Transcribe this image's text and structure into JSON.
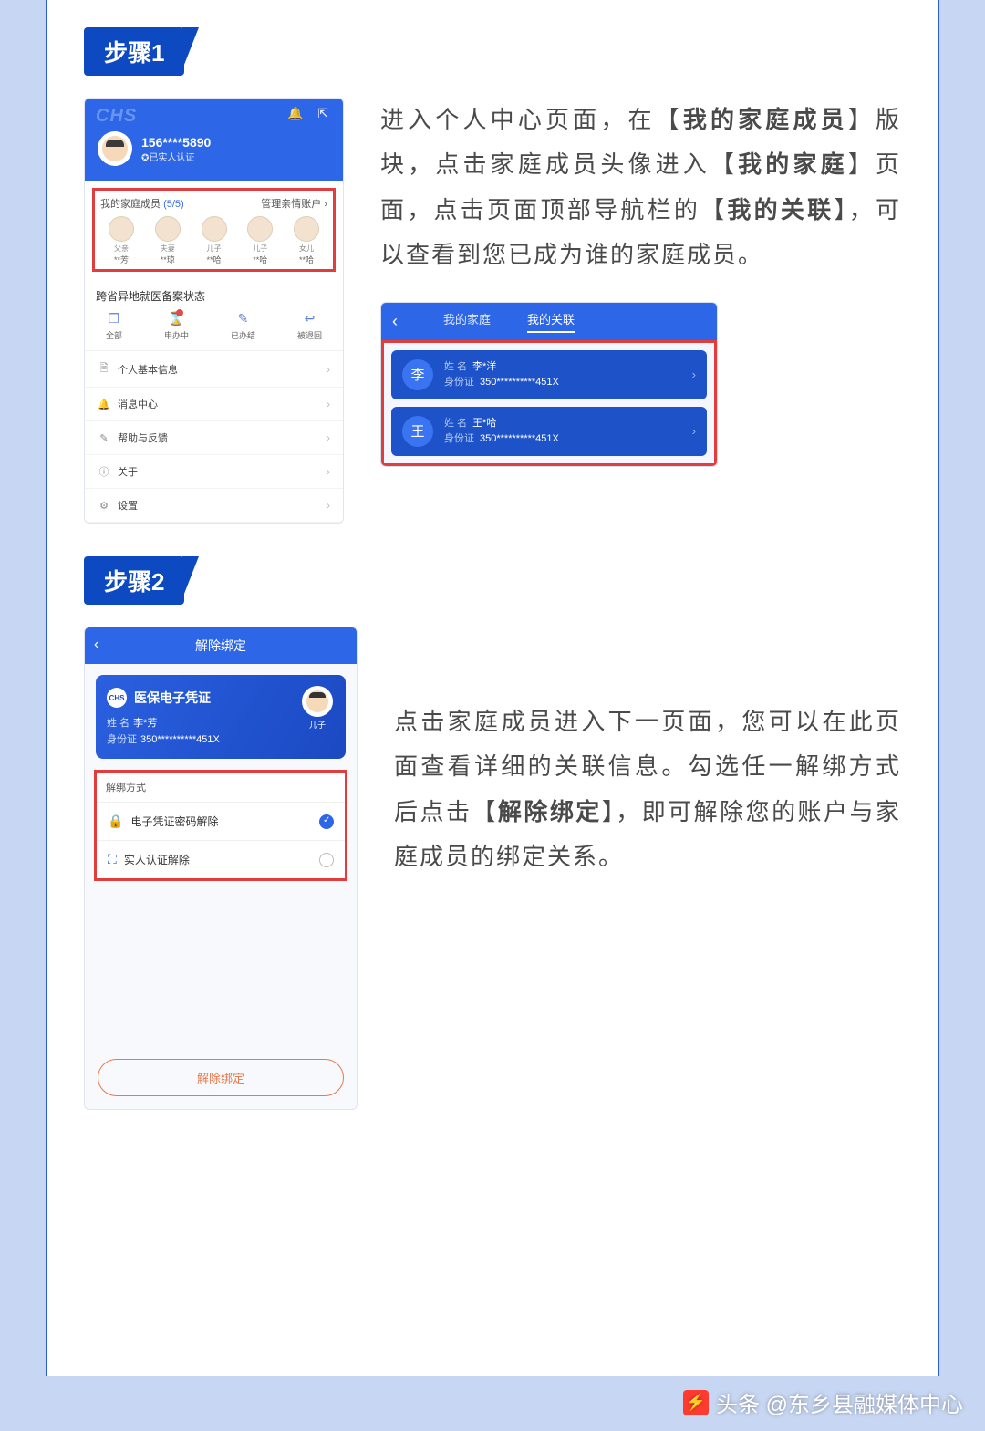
{
  "steps": {
    "s1": "步骤1",
    "s2": "步骤2"
  },
  "desc1": {
    "p1a": "进入个人中心页面，在【",
    "b1": "我的家庭成员",
    "p1b": "】版块，点击家庭成员头像进入【",
    "b2": "我的家庭",
    "p1c": "】页面，点击页面顶部导航栏的【",
    "b3": "我的关联",
    "p1d": "】，可以查看到您已成为谁的家庭成员。"
  },
  "desc2": {
    "p1": "点击家庭成员进入下一页面，您可以在此页面查看详细的关联信息。勾选任一解绑方式后点击【",
    "b1": "解除绑定",
    "p2": "】，即可解除您的账户与家庭成员的绑定关系。"
  },
  "screen1": {
    "logo": "CHS",
    "phone": "156****5890",
    "verified": "✪已实人认证",
    "family_title": "我的家庭成员",
    "family_count": "(5/5)",
    "manage": "管理亲情账户",
    "members": [
      {
        "rel": "父亲",
        "name": "**芳"
      },
      {
        "rel": "夫妻",
        "name": "**琼"
      },
      {
        "rel": "儿子",
        "name": "**哈"
      },
      {
        "rel": "儿子",
        "name": "**哈"
      },
      {
        "rel": "女儿",
        "name": "**哈"
      }
    ],
    "sec_title": "跨省异地就医备案状态",
    "statuses": [
      {
        "ico": "❐",
        "label": "全部"
      },
      {
        "ico": "⌛",
        "label": "申办中",
        "dot": true
      },
      {
        "ico": "✎",
        "label": "已办结"
      },
      {
        "ico": "↩",
        "label": "被退回"
      }
    ],
    "menu": [
      {
        "ico": "🗎",
        "label": "个人基本信息"
      },
      {
        "ico": "🔔",
        "label": "消息中心"
      },
      {
        "ico": "✎",
        "label": "帮助与反馈"
      },
      {
        "ico": "ⓘ",
        "label": "关于"
      },
      {
        "ico": "⚙",
        "label": "设置"
      }
    ]
  },
  "related": {
    "tab1": "我的家庭",
    "tab2": "我的关联",
    "name_label": "姓 名",
    "id_label": "身份证",
    "items": [
      {
        "av": "李",
        "name": "李*洋",
        "id": "350**********451X"
      },
      {
        "av": "王",
        "name": "王*哈",
        "id": "350**********451X"
      }
    ]
  },
  "screen2": {
    "title": "解除绑定",
    "card_title": "医保电子凭证",
    "name_label": "姓 名",
    "name": "李*芳",
    "id_label": "身份证",
    "id": "350**********451X",
    "son_label": "儿子",
    "section": "解绑方式",
    "opt1": "电子凭证密码解除",
    "opt2": "实人认证解除",
    "btn": "解除绑定"
  },
  "watermark": "头条 @东乡县融媒体中心"
}
